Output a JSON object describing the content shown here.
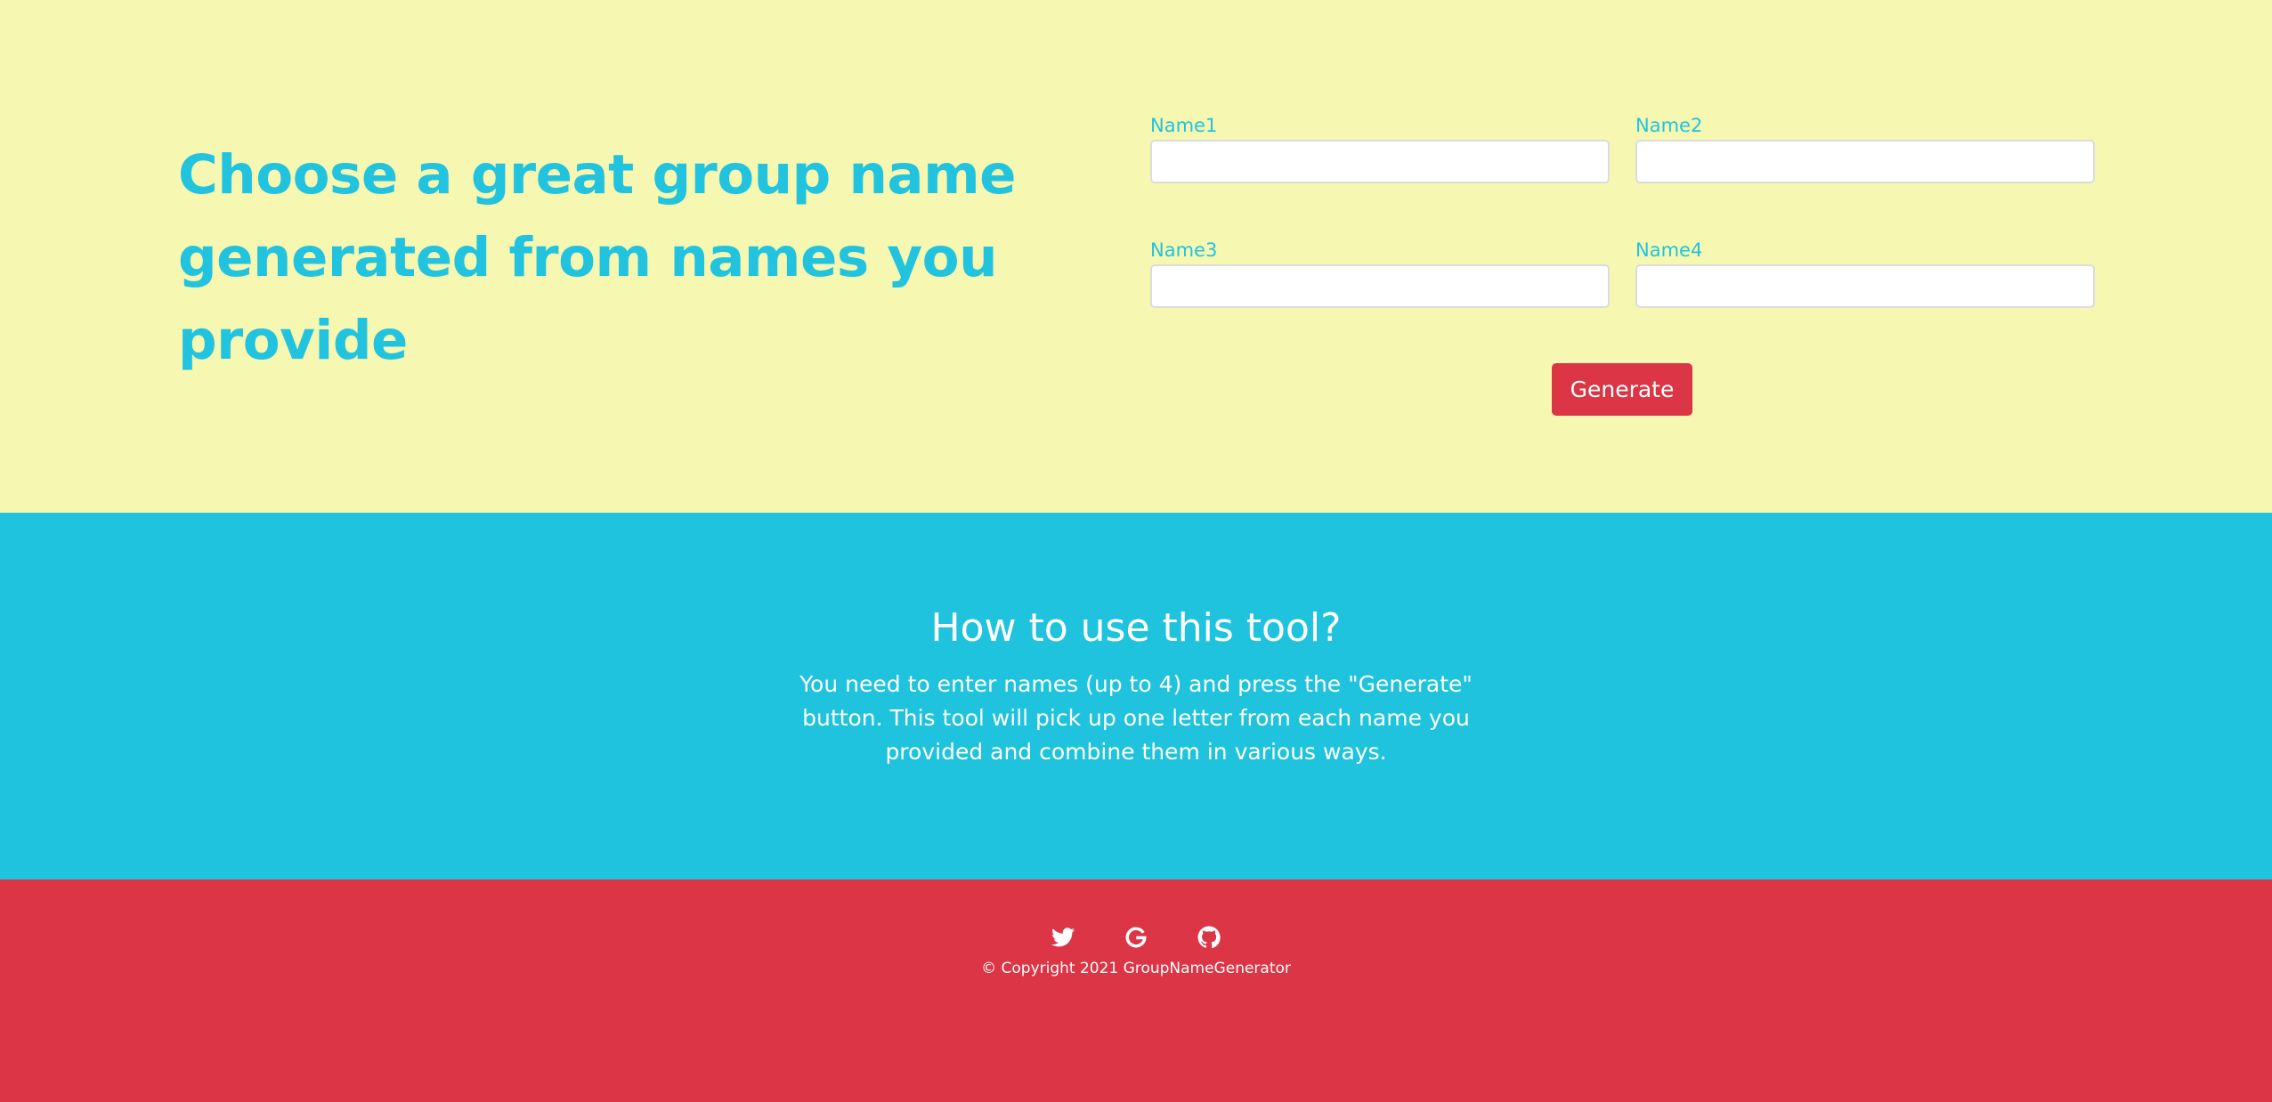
{
  "hero": {
    "headline": "Choose a great group name generated from names you provide"
  },
  "form": {
    "fields": [
      {
        "label": "Name1",
        "value": ""
      },
      {
        "label": "Name2",
        "value": ""
      },
      {
        "label": "Name3",
        "value": ""
      },
      {
        "label": "Name4",
        "value": ""
      }
    ],
    "generate_label": "Generate"
  },
  "info": {
    "title": "How to use this tool?",
    "body": "You need to enter names (up to 4) and press the \"Generate\" button. This tool will pick up one letter from each name you provided and combine them in various ways."
  },
  "footer": {
    "social": [
      {
        "icon": "twitter-icon"
      },
      {
        "icon": "google-icon"
      },
      {
        "icon": "github-icon"
      }
    ],
    "copyright": "© Copyright 2021 GroupNameGenerator"
  },
  "colors": {
    "hero_bg": "#f6f7b1",
    "accent": "#21c3df",
    "info_bg": "#1fc3dd",
    "footer_bg": "#dc3545",
    "button": "#dc3545"
  }
}
